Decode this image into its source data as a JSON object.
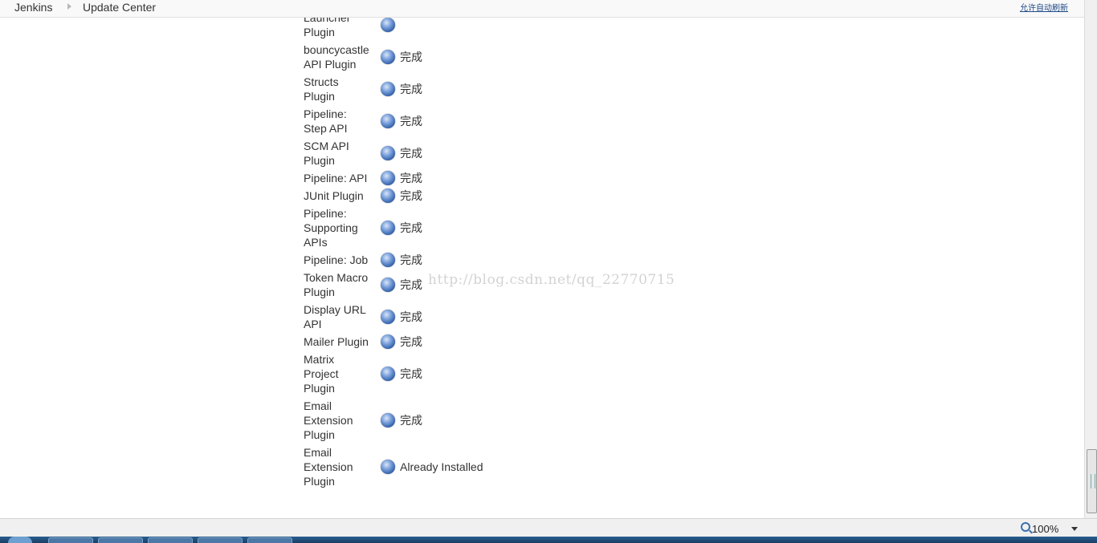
{
  "breadcrumb": {
    "root": "Jenkins",
    "current": "Update Center",
    "auto_refresh": "允许自动刷新"
  },
  "plugins": [
    {
      "name_lines": [
        "Launcher",
        "Plugin"
      ],
      "status": ""
    },
    {
      "name_lines": [
        "bouncycastle",
        "API Plugin"
      ],
      "status": "完成"
    },
    {
      "name_lines": [
        "Structs",
        "Plugin"
      ],
      "status": "完成"
    },
    {
      "name_lines": [
        "Pipeline:",
        "Step API"
      ],
      "status": "完成"
    },
    {
      "name_lines": [
        "SCM API",
        "Plugin"
      ],
      "status": "完成"
    },
    {
      "name_lines": [
        "Pipeline: API"
      ],
      "status": "完成"
    },
    {
      "name_lines": [
        "JUnit Plugin"
      ],
      "status": "完成"
    },
    {
      "name_lines": [
        "Pipeline:",
        "Supporting",
        "APIs"
      ],
      "status": "完成"
    },
    {
      "name_lines": [
        "Pipeline: Job"
      ],
      "status": "完成"
    },
    {
      "name_lines": [
        "Token Macro",
        "Plugin"
      ],
      "status": "完成"
    },
    {
      "name_lines": [
        "Display URL",
        "API"
      ],
      "status": "完成"
    },
    {
      "name_lines": [
        "Mailer Plugin"
      ],
      "status": "完成"
    },
    {
      "name_lines": [
        "Matrix",
        "Project",
        "Plugin"
      ],
      "status": "完成"
    },
    {
      "name_lines": [
        "Email",
        "Extension",
        "Plugin"
      ],
      "status": "完成"
    },
    {
      "name_lines": [
        "Email",
        "Extension",
        "Plugin"
      ],
      "status": "Already Installed"
    }
  ],
  "watermark": "http://blog.csdn.net/qq_22770715",
  "status_bar": {
    "zoom": "100%"
  },
  "colors": {
    "status_ball": "#3b6bb5",
    "link": "#204a87"
  }
}
